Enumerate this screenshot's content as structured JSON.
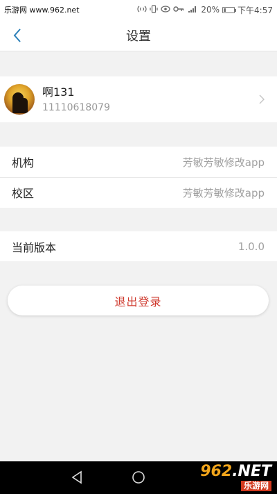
{
  "status_bar": {
    "watermark": "乐游网 www.962.net",
    "battery_percent": "20%",
    "time": "下午4:57",
    "icons": [
      "nfc-icon",
      "vibrate-icon",
      "eye-icon",
      "key-icon",
      "signal-4g-icon",
      "battery-icon"
    ]
  },
  "header": {
    "title": "设置",
    "back_icon": "chevron-left-icon"
  },
  "profile": {
    "name": "啊131",
    "phone": "11110618079"
  },
  "org": [
    {
      "label": "机构",
      "value": "芳敏芳敏修改app"
    },
    {
      "label": "校区",
      "value": "芳敏芳敏修改app"
    }
  ],
  "version": {
    "label": "当前版本",
    "value": "1.0.0"
  },
  "logout_label": "退出登录",
  "brand": {
    "logo_text": "962",
    "logo_suffix": ".NET",
    "tagline": "乐游网"
  },
  "colors": {
    "accent_back": "#2a7fb8",
    "logout_text": "#cf3a2e",
    "background": "#f2f2f2"
  }
}
